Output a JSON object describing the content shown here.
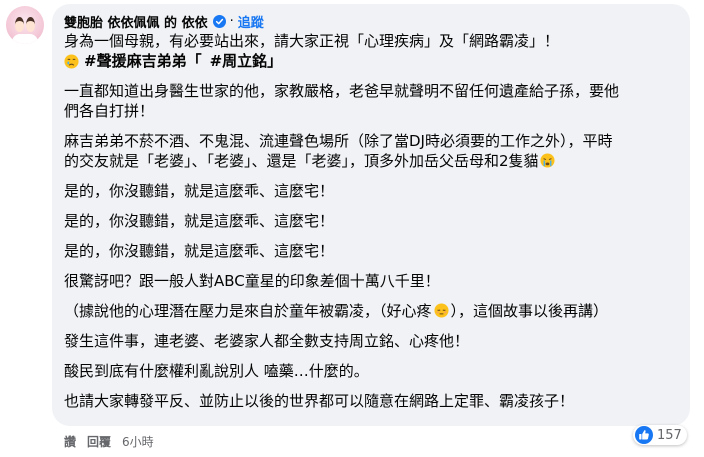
{
  "post": {
    "author": "雙胞胎 依依佩佩 的 依依",
    "separator": "·",
    "follow_label": "追蹤",
    "line1": "身為一個母親，有必要站出來，請大家正視「心理疾病」及「網路霸凌」！",
    "hashtag1": "#聲援麻吉弟弟「",
    "hashtag2": "#周立銘」",
    "para2_line1": "一直都知道出身醫生世家的他，家教嚴格，老爸早就聲明不留任何遺產給子孫，要他",
    "para2_line2": "們各自打拼！",
    "para3_line1": "麻吉弟弟不菸不酒、不鬼混、流連聲色場所（除了當DJ時必須要的工作之外），平時",
    "para3_line2": "的交友就是「老婆」、「老婆」、還是「老婆」，頂多外加岳父岳母和2隻貓",
    "repeat_line_a": "是的，你沒聽錯，就是這麼乖、這麼宅！",
    "repeat_line_b": "是的，你沒聽錯，就是這麼乖、這麼宅！",
    "repeat_line_c": "是的，你沒聽錯，就是這麼乖、這麼宅！",
    "surprise_line": "很驚訝吧？跟一般人對ABC童星的印象差個十萬八千里！",
    "story_pre": "（據說他的心理潛在壓力是來自於童年被霸凌，（好心疼",
    "story_post": "），這個故事以後再講）",
    "support_line": "發生這件事，連老婆、老婆家人都全數支持周立銘、心疼他！",
    "critic_line": "酸民到底有什麼權利亂說別人 嗑藥…什麼的。",
    "call_line": "也請大家轉發平反、並防止以後的世界都可以隨意在網路上定罪、霸凌孩子！"
  },
  "footer": {
    "like_label": "讚",
    "reply_label": "回覆",
    "time_label": "6小時"
  },
  "reactions": {
    "count": "157"
  },
  "icons": {
    "verified": "verified-badge-icon",
    "crying_face": "crying-face-emoji",
    "tears_face": "tears-face-emoji",
    "pensive_face": "pensive-face-emoji",
    "like": "like-thumbs-up-icon"
  },
  "colors": {
    "bubble_bg": "#f0f2f5",
    "text": "#050505",
    "secondary_text": "#65676b",
    "accent_blue": "#1877f2"
  }
}
